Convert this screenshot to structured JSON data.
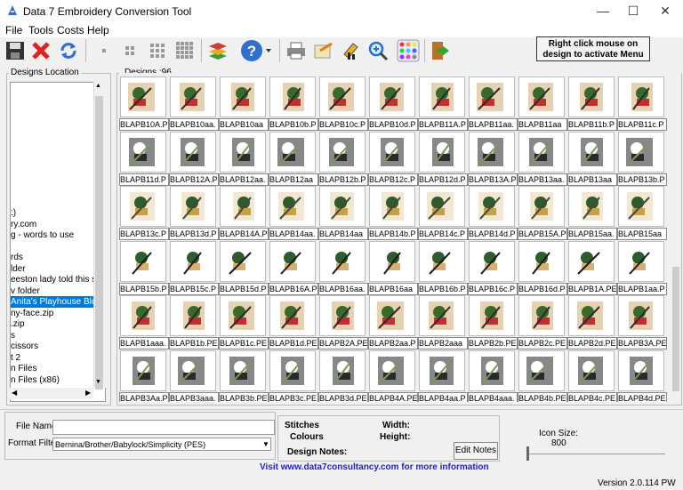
{
  "window": {
    "title": "Data 7 Embroidery Conversion Tool",
    "minimize": "—",
    "maximize": "☐",
    "close": "✕"
  },
  "menu": [
    "File",
    "Tools",
    "Costs",
    "Help"
  ],
  "toolbar": {
    "activate_text": "Right click mouse on design to activate Menu"
  },
  "tree": {
    "label": "Designs Location",
    "items": [
      ":)",
      "ry.com",
      "g - words to use",
      "",
      "rds",
      "lder",
      "eeston lady told this stor",
      "v folder",
      "Anita's Playhouse Block",
      "ny-face.zip",
      ".zip",
      "s",
      "cissors",
      "t 2",
      "n Files",
      "n Files (x86)"
    ],
    "selected_index": 8
  },
  "grid": {
    "label": "Designs :96",
    "items": [
      "BLAPB10A.P",
      "BLAPB10aa.",
      "BLAPB10aa",
      "BLAPB10b.P",
      "BLAPB10c.P",
      "BLAPB10d.P",
      "BLAPB11A.P",
      "BLAPB11aa.",
      "BLAPB11aa",
      "BLAPB11b.P",
      "BLAPB11c.P",
      "BLAPB11d.P",
      "BLAPB12A.P",
      "BLAPB12aa.",
      "BLAPB12aa",
      "BLAPB12b.P",
      "BLAPB12c.P",
      "BLAPB12d.P",
      "BLAPB13A.P",
      "BLAPB13aa.",
      "BLAPB13aa",
      "BLAPB13b.P",
      "BLAPB13c.P",
      "BLAPB13d.P",
      "BLAPB14A.P",
      "BLAPB14aa.",
      "BLAPB14aa",
      "BLAPB14b.P",
      "BLAPB14c.P",
      "BLAPB14d.P",
      "BLAPB15A.P",
      "BLAPB15aa.",
      "BLAPB15aa",
      "BLAPB15b.P",
      "BLAPB15c.P",
      "BLAPB15d.P",
      "BLAPB16A.P",
      "BLAPB16aa.",
      "BLAPB16aa",
      "BLAPB16b.P",
      "BLAPB16c.P",
      "BLAPB16d.P",
      "BLAPB1A.PE",
      "BLAPB1aa.P",
      "BLAPB1aaa.",
      "BLAPB1b.PE",
      "BLAPB1c.PE",
      "BLAPB1d.PE",
      "BLAPB2A.PE",
      "BLAPB2aa.P",
      "BLAPB2aaa",
      "BLAPB2b.PE",
      "BLAPB2c.PE",
      "BLAPB2d.PE",
      "BLAPB3A.PE",
      "BLAPB3Aa.P",
      "BLAPB3aaa.",
      "BLAPB3b.PE",
      "BLAPB3c.PE",
      "BLAPB3d.PE",
      "BLAPB4A.PE",
      "BLAPB4aa.P",
      "BLAPB4aaa.",
      "BLAPB4b.PE",
      "BLAPB4c.PE",
      "BLAPB4d.PE"
    ]
  },
  "bottom": {
    "file_name_label": "File Name",
    "format_filter_label": "Format Filter",
    "format_filter_value": "Bernina/Brother/Babylock/Simplicity (PES)",
    "stitches_label": "Stitches",
    "colours_label": "Colours",
    "width_label": "Width:",
    "height_label": "Height:",
    "design_notes_label": "Design Notes:",
    "edit_notes_label": "Edit Notes",
    "icon_size_label": "Icon Size:",
    "icon_size_value": "800",
    "link_text": "Visit www.data7consultancy.com for more information",
    "version": "Version 2.0.114 PW"
  },
  "colors": {
    "selection": "#0078d7",
    "link": "#2222cc"
  }
}
